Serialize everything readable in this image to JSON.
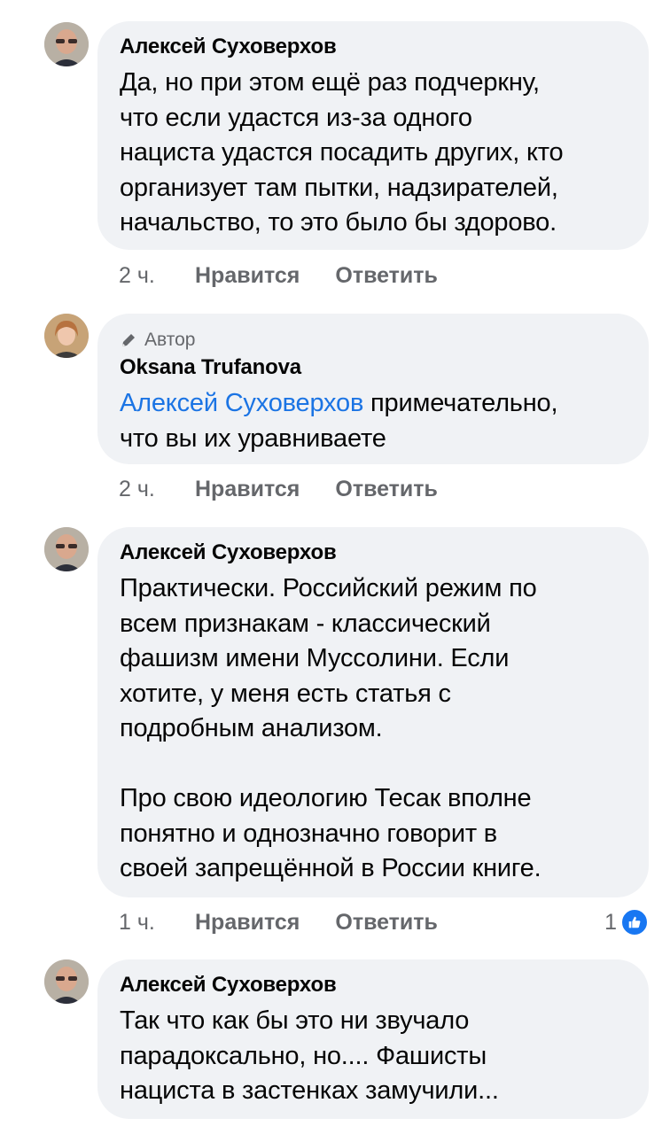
{
  "comments": [
    {
      "author": "Алексей Суховерхов",
      "text": "Да, но при этом ещё раз подчеркну,\nчто если удастся из-за одного\nнациста удастся посадить других, кто\nорганизует там пытки, надзирателей,\nначальство, то это было бы здорово.",
      "time": "2 ч.",
      "like_label": "Нравится",
      "reply_label": "Ответить"
    },
    {
      "badge": "Автор",
      "author": "Oksana Trufanova",
      "mention": "Алексей Суховерхов",
      "text": " примечательно,\nчто вы их уравниваете",
      "time": "2 ч.",
      "like_label": "Нравится",
      "reply_label": "Ответить"
    },
    {
      "author": "Алексей Суховерхов",
      "text": "Практически. Российский режим по\nвсем признакам - классический\nфашизм имени Муссолини. Если\nхотите, у меня есть статья с\nподробным анализом.\n\nПро свою идеологию Тесак вполне\nпонятно и однозначно говорит в\nсвоей запрещённой в России книге.",
      "time": "1 ч.",
      "like_label": "Нравится",
      "reply_label": "Ответить",
      "reaction_count": "1",
      "reaction_icon": "thumbs-up-icon"
    },
    {
      "author": "Алексей Суховерхов",
      "text": "Так что как бы это ни звучало\nпарадоксально, но.... Фашисты\nнациста в застенках замучили..."
    }
  ],
  "colors": {
    "bubble": "#f0f2f5",
    "mention": "#1b74e4",
    "meta": "#65676b",
    "like_badge": "#1877f2"
  }
}
